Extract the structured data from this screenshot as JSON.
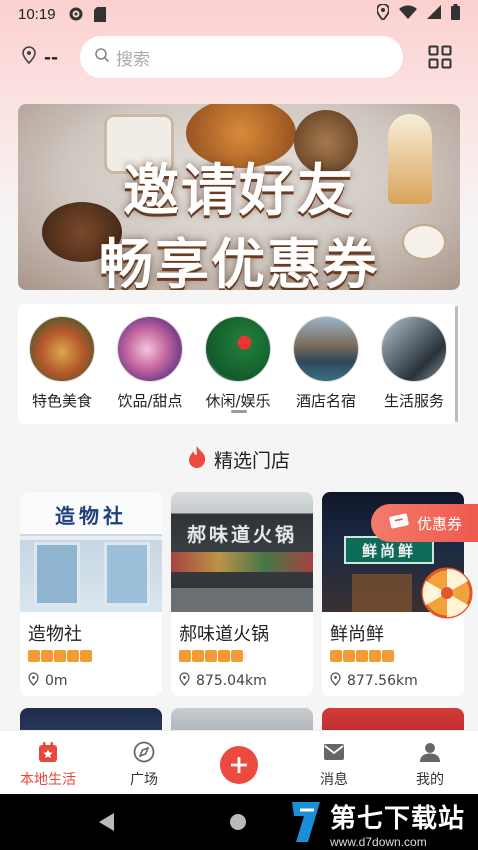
{
  "status_bar": {
    "time": "10:19",
    "icons_left": [
      "settings-icon",
      "sd-card-icon"
    ],
    "icons_right": [
      "location-icon",
      "wifi-icon",
      "signal-icon",
      "battery-icon"
    ]
  },
  "header": {
    "location_value": "--",
    "search_placeholder": "搜索",
    "grid_icon": "grid-menu-icon"
  },
  "banner": {
    "line1": "邀请好友",
    "line2": "畅享优惠券"
  },
  "categories": [
    {
      "label": "特色美食",
      "icon": "food-photo"
    },
    {
      "label": "饮品/甜点",
      "icon": "dessert-photo"
    },
    {
      "label": "休闲/娱乐",
      "icon": "billiards-photo"
    },
    {
      "label": "酒店名宿",
      "icon": "hotel-photo"
    },
    {
      "label": "生活服务",
      "icon": "service-photo"
    }
  ],
  "section": {
    "title": "精选门店"
  },
  "stores": [
    {
      "name": "造物社",
      "distance": "0m",
      "sign_text": "造物社",
      "rating": 5
    },
    {
      "name": "郝味道火锅",
      "distance": "875.04km",
      "sign_text": "郝味道火锅",
      "rating": 5
    },
    {
      "name": "鲜尚鲜",
      "distance": "877.56km",
      "sign_text": "鲜尚鲜",
      "rating": 5
    }
  ],
  "coupon": {
    "label": "优惠券"
  },
  "bottom_nav": [
    {
      "label": "本地生活",
      "icon": "local-life-icon",
      "active": true
    },
    {
      "label": "广场",
      "icon": "compass-icon",
      "active": false
    },
    {
      "label": "",
      "icon": "plus-icon",
      "active": false
    },
    {
      "label": "消息",
      "icon": "mail-icon",
      "active": false
    },
    {
      "label": "我的",
      "icon": "profile-icon",
      "active": false
    }
  ],
  "watermark": {
    "main": "第七下载站",
    "sub": "www.d7down.com"
  },
  "colors": {
    "accent": "#e8463a",
    "star": "#f39c34",
    "coupon": "#ee5a4e"
  }
}
